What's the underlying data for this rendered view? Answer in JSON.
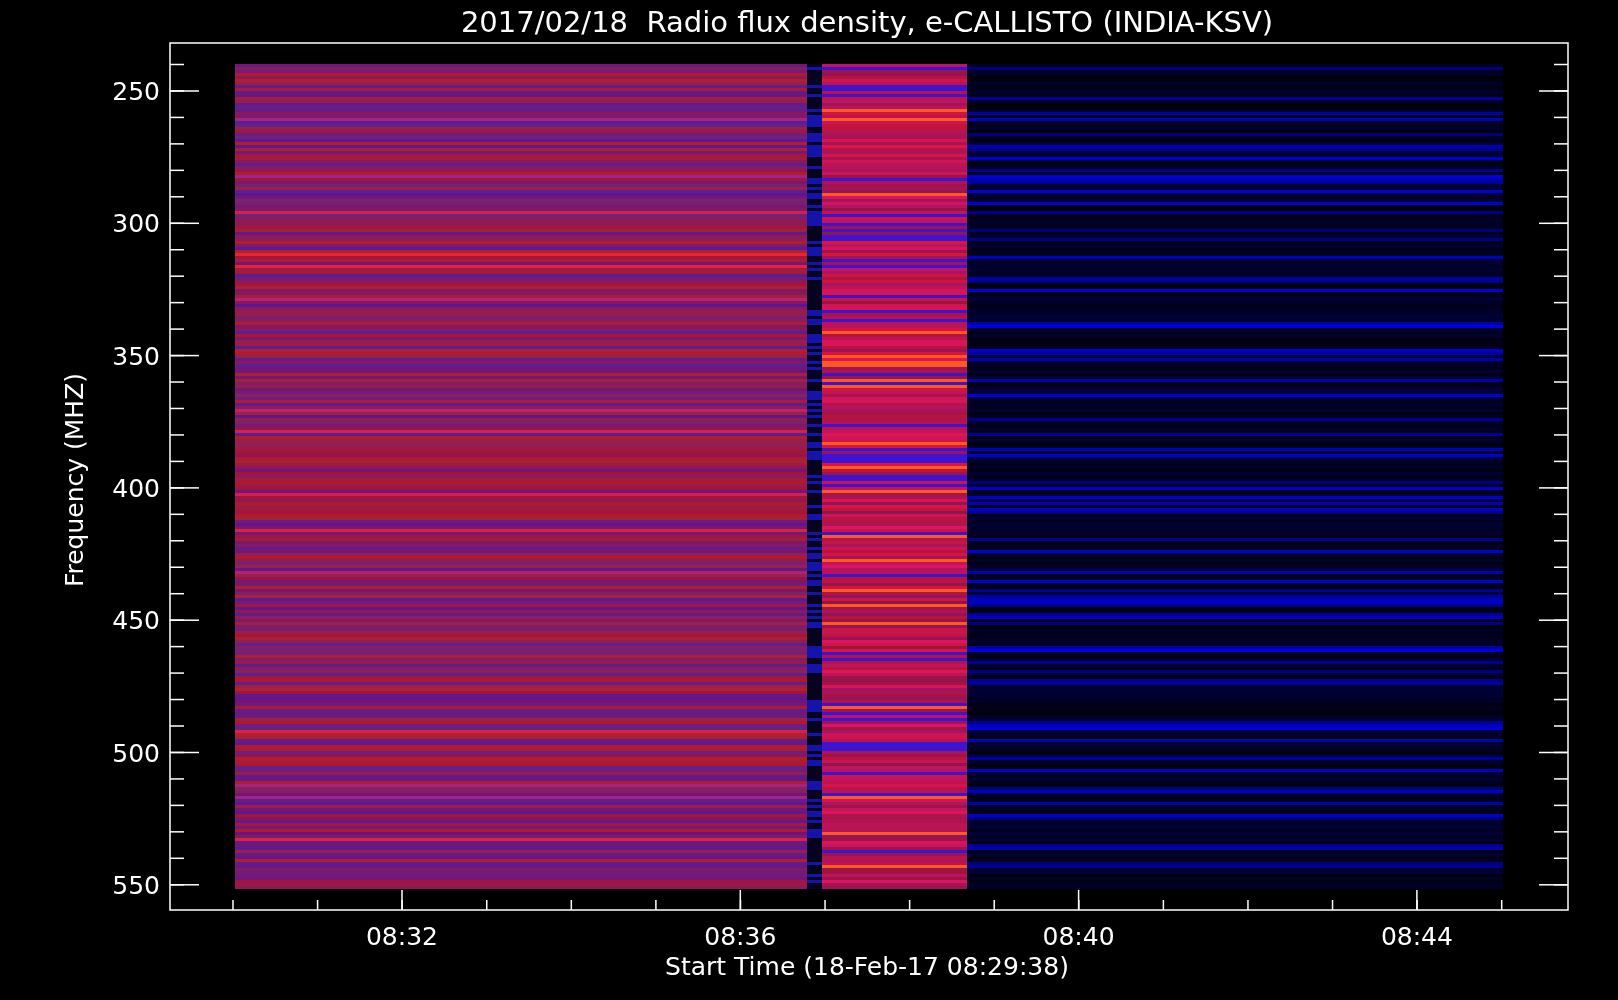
{
  "title": "2017/02/18  Radio flux density, e-CALLISTO (INDIA-KSV)",
  "y_axis": {
    "label": "Frequency (MHZ)",
    "ticks": [
      "250",
      "300",
      "350",
      "400",
      "450",
      "500",
      "550"
    ]
  },
  "x_axis": {
    "label": "Start Time (18-Feb-17 08:29:38)",
    "ticks": [
      "08:32",
      "08:36",
      "08:40",
      "08:44"
    ]
  }
}
